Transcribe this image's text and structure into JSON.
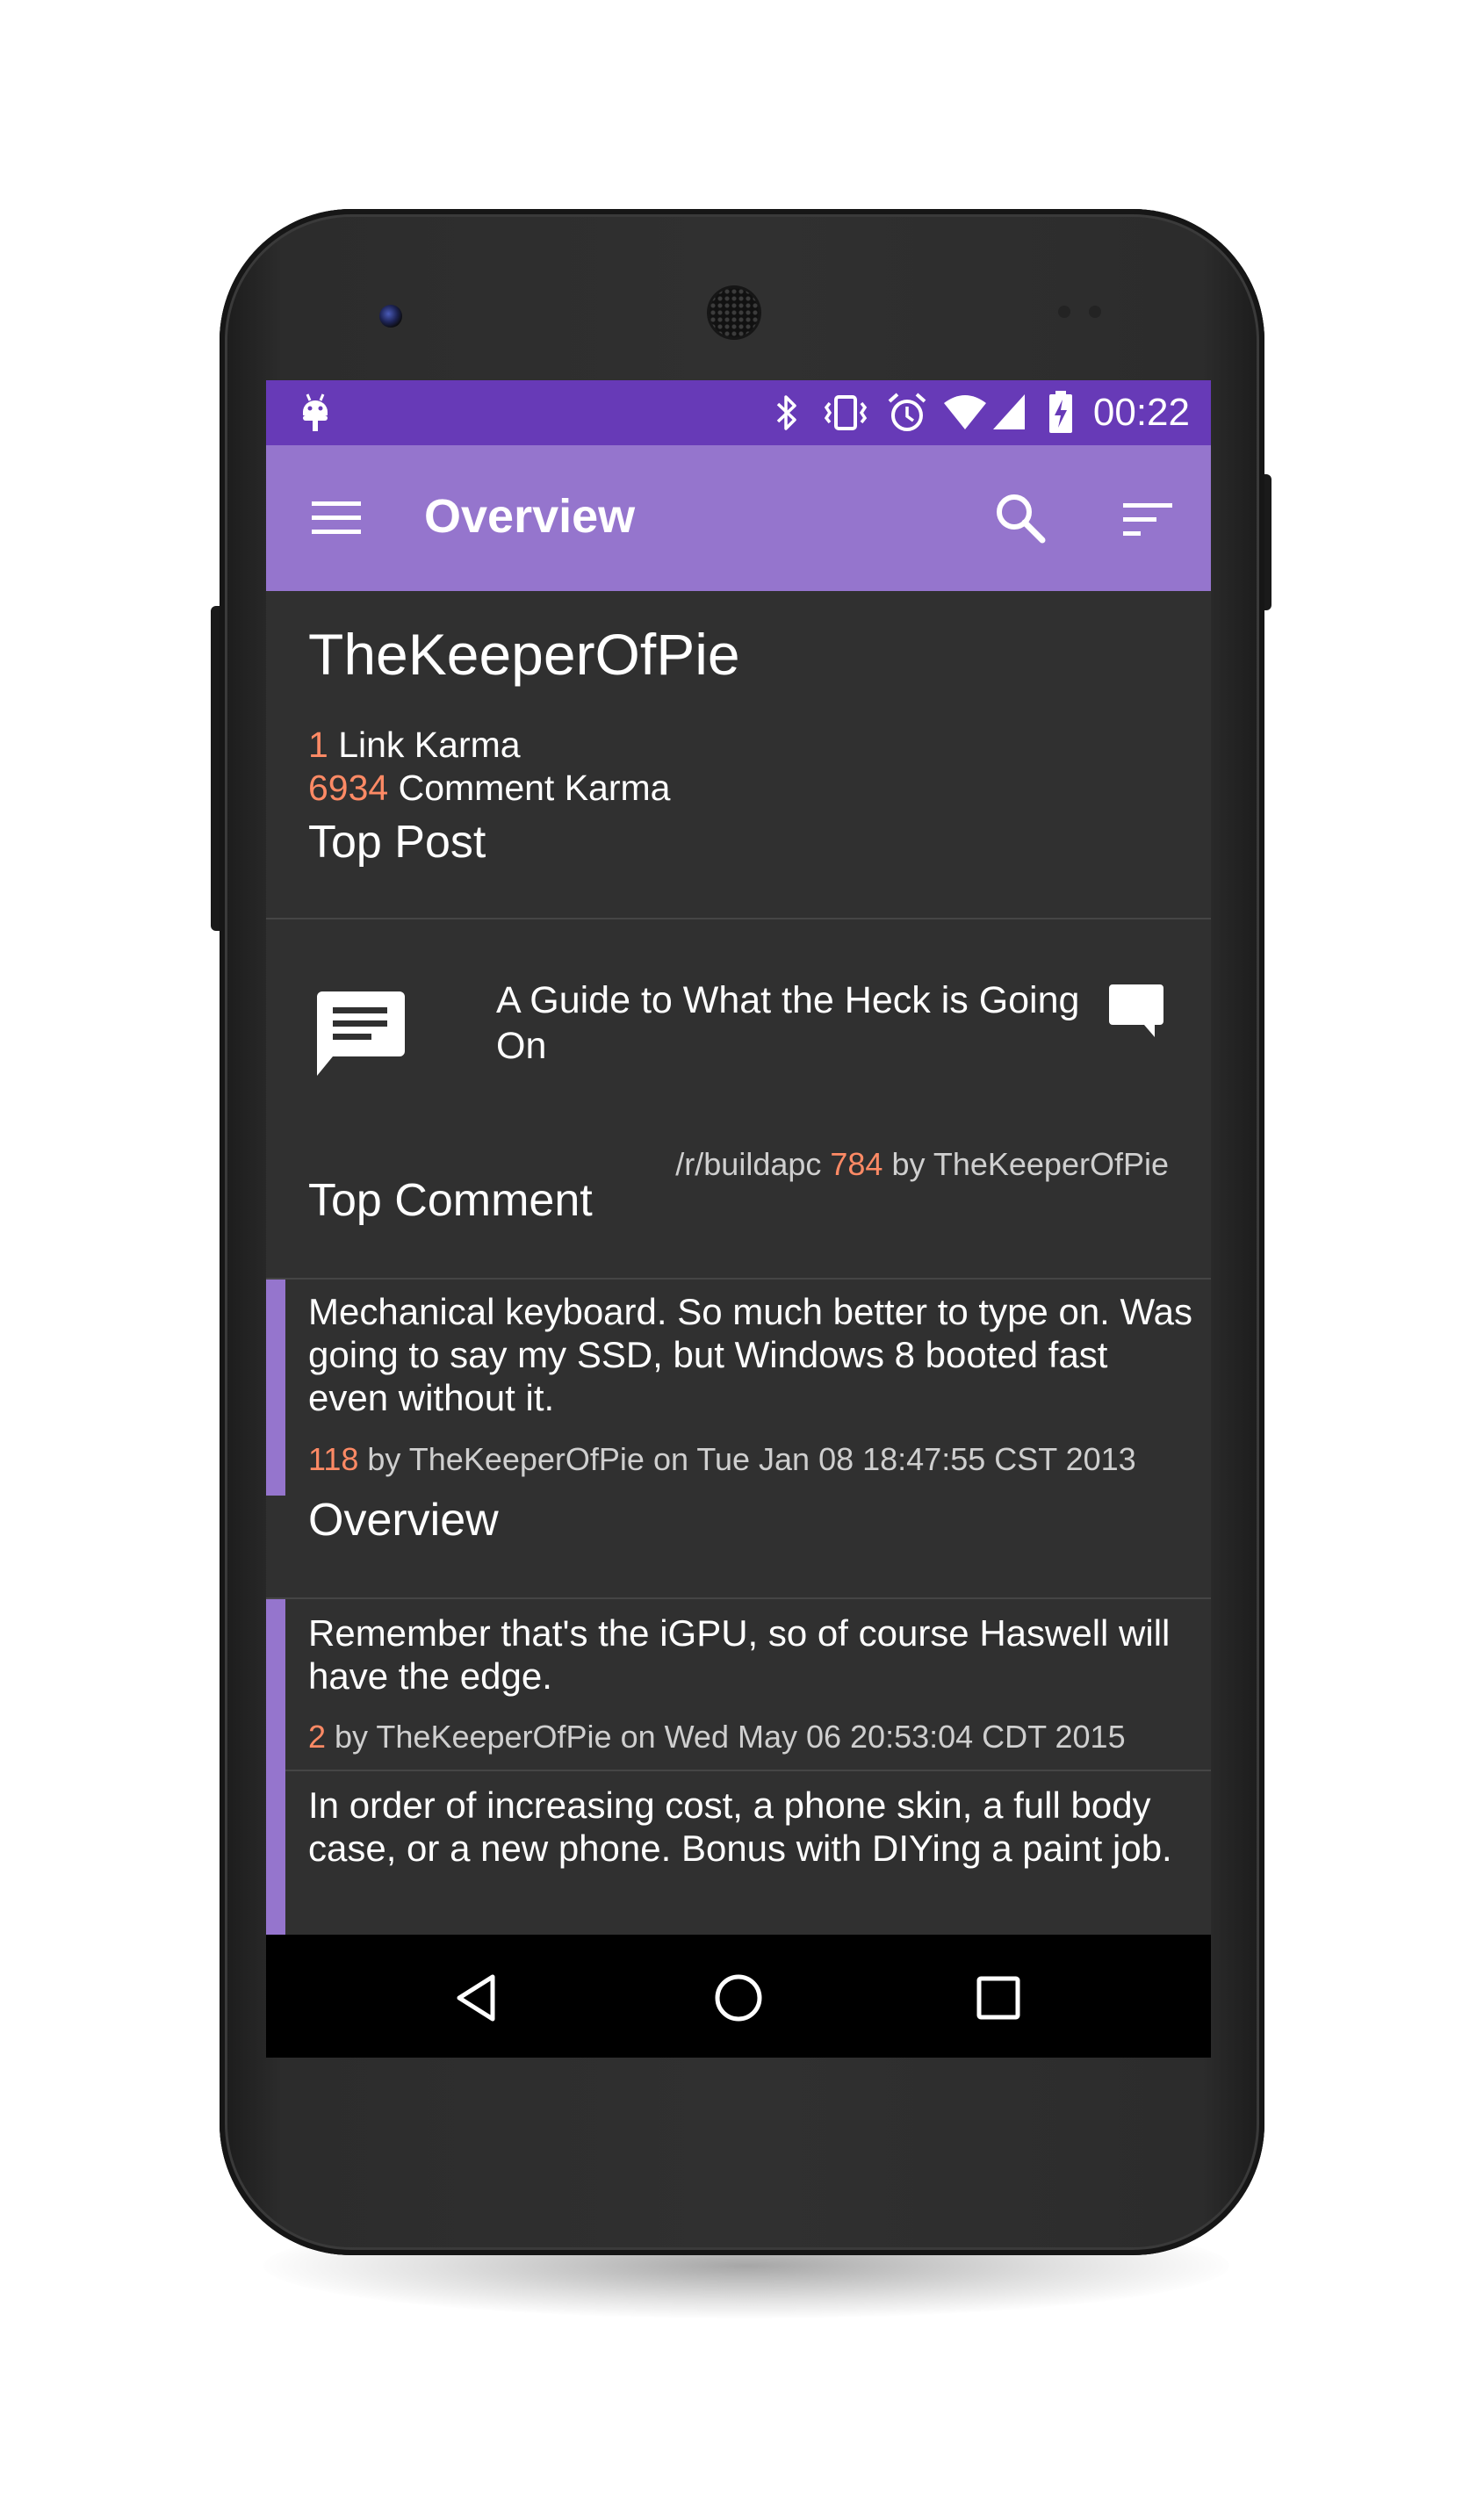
{
  "status_bar": {
    "time": "00:22",
    "icons": [
      "android-notification-icon",
      "bluetooth-icon",
      "vibrate-icon",
      "alarm-icon",
      "wifi-icon",
      "cell-signal-icon",
      "battery-charging-icon"
    ]
  },
  "toolbar": {
    "title": "Overview",
    "icons": [
      "menu-icon",
      "search-icon",
      "sort-icon"
    ]
  },
  "profile": {
    "username": "TheKeeperOfPie",
    "link_karma": {
      "value": "1",
      "label": " Link Karma"
    },
    "comment_karma": {
      "value": "6934",
      "label": " Comment Karma"
    }
  },
  "top_post": {
    "section_title": "Top Post",
    "title": "A Guide to What the Heck is Going On",
    "subreddit": "/r/buildapc ",
    "score": "784",
    "author": " by TheKeeperOfPie",
    "thumbnail_icon": "text-post-icon",
    "comments_icon": "comment-icon"
  },
  "top_comment": {
    "section_title": "Top Comment",
    "body": "Mechanical keyboard. So much better to type on. Was going to say my SSD, but Windows 8 booted fast even without it.",
    "score": "118",
    "meta": " by TheKeeperOfPie on Tue Jan 08 18:47:55 CST 2013"
  },
  "overview": {
    "section_title": "Overview",
    "items": [
      {
        "body": "Remember that's the iGPU, so of course Haswell will have the edge.",
        "score": "2",
        "meta": " by TheKeeperOfPie on Wed May 06 20:53:04 CDT 2015"
      },
      {
        "body": "In order of increasing cost, a phone skin, a full body case, or a new phone. Bonus with DIYing a paint job."
      }
    ]
  },
  "nav_bar": {
    "icons": [
      "back-icon",
      "home-icon",
      "recents-icon"
    ]
  },
  "colors": {
    "status_bar": "#673ab7",
    "toolbar": "#9575cd",
    "background": "#303030",
    "score_accent": "#ff8a65",
    "comment_accent": "#9575cd"
  }
}
